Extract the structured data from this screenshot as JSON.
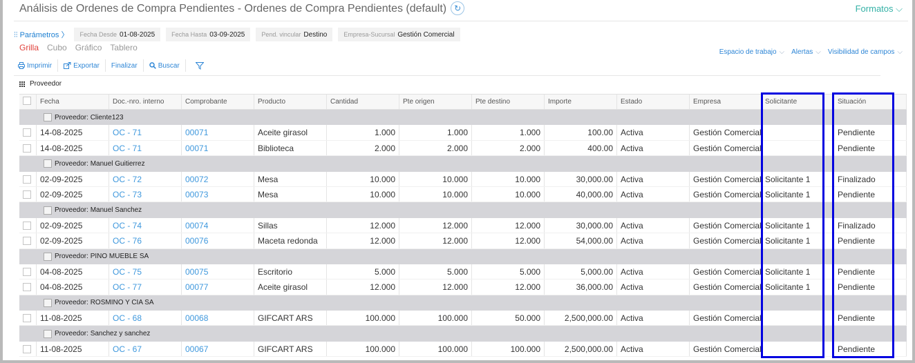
{
  "title": "Análisis de Ordenes de Compra Pendientes - Ordenes de Compra Pendientes (default)",
  "formatos_label": "Formatos",
  "params": {
    "label": "Parámetros",
    "fecha_desde": {
      "label": "Fecha Desde",
      "value": "01-08-2025"
    },
    "fecha_hasta": {
      "label": "Fecha Hasta",
      "value": "03-09-2025"
    },
    "pend_vincular": {
      "label": "Pend. vincular",
      "value": "Destino"
    },
    "empresa": {
      "label": "Empresa-Sucursal",
      "value": "Gestión Comercial"
    }
  },
  "views": [
    "Grilla",
    "Cubo",
    "Gráfico",
    "Tablero"
  ],
  "workspace": [
    "Espacio de trabajo",
    "Alertas",
    "Visibilidad de campos"
  ],
  "toolbar": {
    "print": "Imprimir",
    "export": "Exportar",
    "finalize": "Finalizar",
    "search": "Buscar"
  },
  "groupby_label": "Proveedor",
  "columns": [
    "Fecha",
    "Doc.-nro. interno",
    "Comprobante",
    "Producto",
    "Cantidad",
    "Pte origen",
    "Pte destino",
    "Importe",
    "Estado",
    "Empresa",
    "Solicitante",
    "Situación"
  ],
  "groups": [
    {
      "label": "Proveedor: Cliente123",
      "rows": [
        [
          "14-08-2025",
          "OC - 71",
          "00071",
          "Aceite girasol",
          "1.000",
          "1.000",
          "1.000",
          "100.00",
          "Activa",
          "Gestión Comercial",
          "",
          "Pendiente"
        ],
        [
          "14-08-2025",
          "OC - 71",
          "00071",
          "Biblioteca",
          "2.000",
          "2.000",
          "2.000",
          "400.00",
          "Activa",
          "Gestión Comercial",
          "",
          "Pendiente"
        ]
      ]
    },
    {
      "label": "Proveedor: Manuel Guitierrez",
      "rows": [
        [
          "02-09-2025",
          "OC - 72",
          "00072",
          "Mesa",
          "10.000",
          "10.000",
          "10.000",
          "30,000.00",
          "Activa",
          "Gestión Comercial",
          "Solicitante 1",
          "Finalizado"
        ],
        [
          "02-09-2025",
          "OC - 73",
          "00073",
          "Mesa",
          "10.000",
          "10.000",
          "10.000",
          "40,000.00",
          "Activa",
          "Gestión Comercial",
          "Solicitante 1",
          "Pendiente"
        ]
      ]
    },
    {
      "label": "Proveedor: Manuel Sanchez",
      "rows": [
        [
          "02-09-2025",
          "OC - 74",
          "00074",
          "Sillas",
          "12.000",
          "12.000",
          "12.000",
          "30,000.00",
          "Activa",
          "Gestión Comercial",
          "Solicitante 1",
          "Finalizado"
        ],
        [
          "02-09-2025",
          "OC - 76",
          "00076",
          "Maceta redonda",
          "12.000",
          "12.000",
          "12.000",
          "54,000.00",
          "Activa",
          "Gestión Comercial",
          "Solicitante 1",
          "Pendiente"
        ]
      ]
    },
    {
      "label": "Proveedor: PINO MUEBLE SA",
      "rows": [
        [
          "04-08-2025",
          "OC - 75",
          "00075",
          "Escritorio",
          "5.000",
          "5.000",
          "5.000",
          "5,000.00",
          "Activa",
          "Gestión Comercial",
          "Solicitante 1",
          "Pendiente"
        ],
        [
          "04-08-2025",
          "OC - 77",
          "00077",
          "Aceite girasol",
          "12.000",
          "12.000",
          "12.000",
          "36,000.00",
          "Activa",
          "Gestión Comercial",
          "Solicitante 1",
          "Pendiente"
        ]
      ]
    },
    {
      "label": "Proveedor: ROSMINO Y CIA SA",
      "rows": [
        [
          "11-08-2025",
          "OC - 68",
          "00068",
          "GIFCART ARS",
          "100.000",
          "100.000",
          "50.000",
          "2,500,000.00",
          "Activa",
          "Gestión Comercial",
          "",
          "Pendiente"
        ]
      ]
    },
    {
      "label": "Proveedor: Sanchez y sanchez",
      "rows": [
        [
          "11-08-2025",
          "OC - 67",
          "00067",
          "GIFCART ARS",
          "100.000",
          "100.000",
          "100.000",
          "2,500,000.00",
          "Activa",
          "Gestión Comercial",
          "",
          "Pendiente"
        ]
      ]
    }
  ],
  "colors": {
    "accent": "#2e86d6",
    "active_view": "#e0413b",
    "formatos": "#34b1a6",
    "highlight": "#0000e0",
    "group_bg": "#d5d5d9"
  }
}
